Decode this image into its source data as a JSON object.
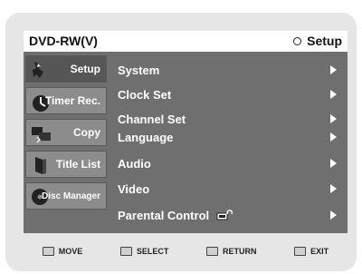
{
  "header": {
    "title": "DVD-RW(V)",
    "section": "Setup"
  },
  "sidebar": {
    "tabs": [
      {
        "label": "Setup",
        "icon": "setup-icon",
        "active": true
      },
      {
        "label": "Timer Rec.",
        "icon": "timer-icon",
        "active": false
      },
      {
        "label": "Copy",
        "icon": "copy-icon",
        "active": false
      },
      {
        "label": "Title List",
        "icon": "title-list-icon",
        "active": false
      },
      {
        "label": "Disc Manager",
        "icon": "disc-icon",
        "active": false
      }
    ]
  },
  "menu": {
    "items": [
      {
        "label": "System"
      },
      {
        "label": "Clock Set"
      },
      {
        "label": "Channel Set"
      },
      {
        "label": "Language"
      },
      {
        "label": "Audio"
      },
      {
        "label": "Video"
      },
      {
        "label": "Parental Control"
      }
    ]
  },
  "footer": {
    "move": "MOVE",
    "select": "SELECT",
    "return": "RETURN",
    "exit": "EXIT"
  },
  "colors": {
    "panel": "#6f6f6f",
    "tab": "#8c8c8c",
    "frame": "#e6e6e6"
  }
}
